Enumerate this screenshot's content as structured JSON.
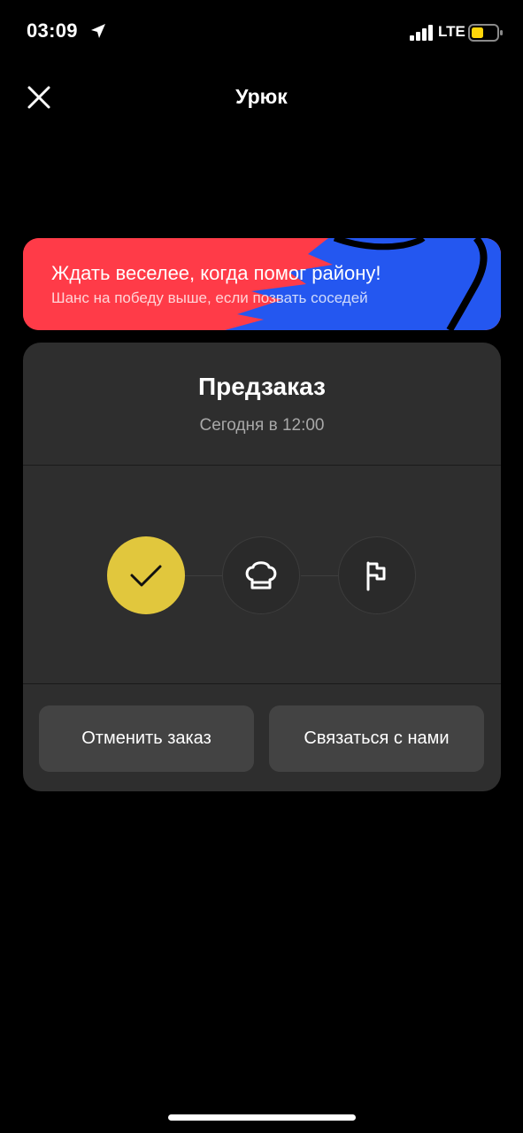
{
  "status_bar": {
    "time": "03:09",
    "network": "LTE",
    "battery_color": "#ffd60a",
    "icons": [
      "location-arrow-icon",
      "signal-bars-icon",
      "battery-icon"
    ]
  },
  "nav": {
    "title": "Урюк",
    "close_icon": "close-icon"
  },
  "promo": {
    "title": "Ждать веселее, когда помог району!",
    "subtitle": "Шанс на победу выше, если позвать соседей",
    "colors": {
      "red": "#ff3b48",
      "blue": "#2457f0"
    }
  },
  "order": {
    "title": "Предзаказ",
    "time": "Сегодня в 12:00",
    "steps": [
      {
        "icon": "checkmark-icon",
        "state": "done"
      },
      {
        "icon": "chef-hat-icon",
        "state": "pending"
      },
      {
        "icon": "flag-icon",
        "state": "pending"
      }
    ],
    "accent_color": "#e1c73d",
    "actions": {
      "cancel_label": "Отменить заказ",
      "contact_label": "Связаться с нами"
    }
  }
}
